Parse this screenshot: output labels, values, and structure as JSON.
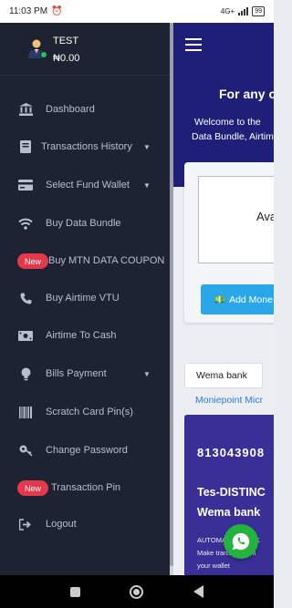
{
  "status_bar": {
    "time": "11:03 PM",
    "network": "4G+",
    "battery": "99"
  },
  "drawer": {
    "user": {
      "name": "TEST",
      "balance": "₦0.00"
    },
    "items": [
      {
        "label": "Dashboard",
        "icon": "bank-icon",
        "caret": false,
        "badge": ""
      },
      {
        "label": "Transactions History",
        "icon": "book-icon",
        "caret": true,
        "badge": ""
      },
      {
        "label": "Select Fund Wallet",
        "icon": "credit-card-icon",
        "caret": true,
        "badge": ""
      },
      {
        "label": "Buy Data Bundle",
        "icon": "wifi-icon",
        "caret": false,
        "badge": ""
      },
      {
        "label": "Buy MTN DATA COUPON",
        "icon": "",
        "caret": false,
        "badge": "New"
      },
      {
        "label": "Buy Airtime VTU",
        "icon": "phone-icon",
        "caret": false,
        "badge": ""
      },
      {
        "label": "Airtime To Cash",
        "icon": "money-icon",
        "caret": false,
        "badge": ""
      },
      {
        "label": "Bills Payment",
        "icon": "lightbulb-icon",
        "caret": true,
        "badge": ""
      },
      {
        "label": "Scratch Card Pin(s)",
        "icon": "barcode-icon",
        "caret": false,
        "badge": ""
      },
      {
        "label": "Change Password",
        "icon": "key-icon",
        "caret": false,
        "badge": ""
      },
      {
        "label": "Transaction Pin",
        "icon": "",
        "caret": false,
        "badge": "New"
      },
      {
        "label": "Logout",
        "icon": "logout-icon",
        "caret": false,
        "badge": ""
      }
    ]
  },
  "main": {
    "hero_title": "For any c",
    "hero_sub_1": "Welcome to the",
    "hero_sub_2": "Data Bundle, Airtim",
    "balance_label": "Ava",
    "add_money_label": "Add Mone",
    "bank_tab": "Wema bank",
    "bank_link": "Moniepoint Micr",
    "account_number": "813043908",
    "account_name_1": "Tes-DISTINC",
    "account_name_2": "Wema bank",
    "account_note_1": "AUTOMATED BANK",
    "account_note_2": "Make transfer to thi",
    "account_note_3": "your wallet"
  },
  "colors": {
    "drawer_bg": "#1d2333",
    "header_bg": "#1f1f7a",
    "accent": "#2aa7e8",
    "badge": "#e5394b",
    "whatsapp": "#25b33f"
  }
}
